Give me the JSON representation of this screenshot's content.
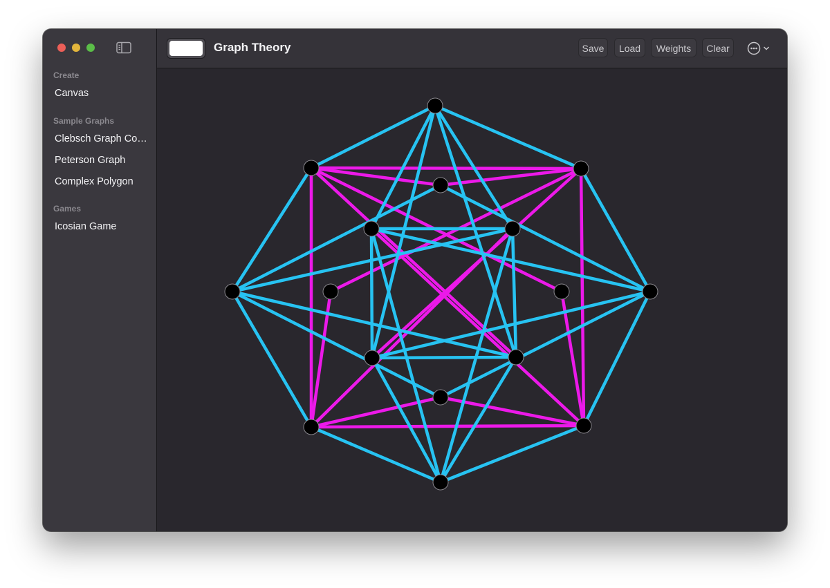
{
  "window": {
    "title": "Graph Theory",
    "swatch_color": "#ffffff"
  },
  "sidebar": {
    "sections": [
      {
        "header": "Create",
        "items": [
          {
            "label": "Canvas"
          }
        ]
      },
      {
        "header": "Sample Graphs",
        "items": [
          {
            "label": "Clebsch Graph Complement"
          },
          {
            "label": "Peterson Graph"
          },
          {
            "label": "Complex Polygon"
          }
        ]
      },
      {
        "header": "Games",
        "items": [
          {
            "label": "Icosian Game"
          }
        ]
      }
    ]
  },
  "toolbar": {
    "save_label": "Save",
    "load_label": "Load",
    "weights_label": "Weights",
    "clear_label": "Clear",
    "more_icon": "ellipsis-circle-icon"
  },
  "graph": {
    "edge_colors": {
      "blue": "#27c3f2",
      "magenta": "#ec19e9"
    },
    "vertex_color": "#000000"
  }
}
